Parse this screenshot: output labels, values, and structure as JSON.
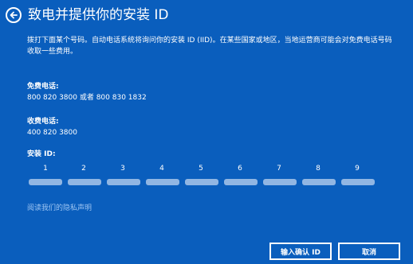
{
  "header": {
    "title": "致电并提供你的安装 ID"
  },
  "description": "拨打下面某个号码。自动电话系统将询问你的安装 ID (IID)。在某些国家或地区，当地运营商可能会对免费电话号码收取一些费用。",
  "toll_free": {
    "label": "免费电话:",
    "value": "800 820 3800 或者 800 830 1832"
  },
  "toll": {
    "label": "收费电话:",
    "value": "400 820 3800"
  },
  "installation_id": {
    "label": "安装 ID:",
    "groups": [
      "1",
      "2",
      "3",
      "4",
      "5",
      "6",
      "7",
      "8",
      "9"
    ]
  },
  "privacy_link": "阅读我们的隐私声明",
  "buttons": {
    "enter_confirmation_id": "输入确认 ID",
    "cancel": "取消"
  },
  "colors": {
    "background": "#0a5ebd",
    "text": "#ffffff",
    "link": "#9cc4f2"
  },
  "icons": {
    "back": "back-arrow-icon"
  }
}
